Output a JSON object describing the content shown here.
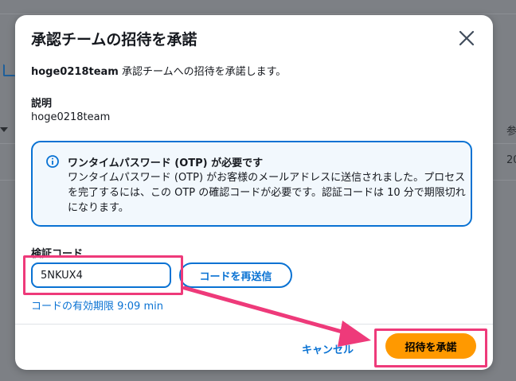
{
  "background": {
    "right_label": "参",
    "right_value": "20"
  },
  "modal": {
    "title": "承認チームの招待を承諾",
    "intro_team": "hoge0218team",
    "intro_text": " 承認チームへの招待を承諾します。",
    "description_label": "説明",
    "description_value": "hoge0218team",
    "alert": {
      "title": "ワンタイムパスワード (OTP) が必要です",
      "body": "ワンタイムパスワード (OTP) がお客様のメールアドレスに送信されました。プロセスを完了するには、この OTP の確認コードが必要です。認証コードは 10 分で期限切れになります。"
    },
    "code_field": {
      "label": "検証コード",
      "value": "5NKUX4"
    },
    "resend_label": "コードを再送信",
    "expiry_text": "コードの有効期限 9:09 min",
    "cancel_label": "キャンセル",
    "accept_label": "招待を承諾"
  },
  "colors": {
    "accent": "#0972d3",
    "primary_button": "#ff9900",
    "annotation": "#ee3a7a"
  },
  "icons": [
    "close-icon",
    "info-icon",
    "external-link-icon",
    "annotation-arrow"
  ]
}
